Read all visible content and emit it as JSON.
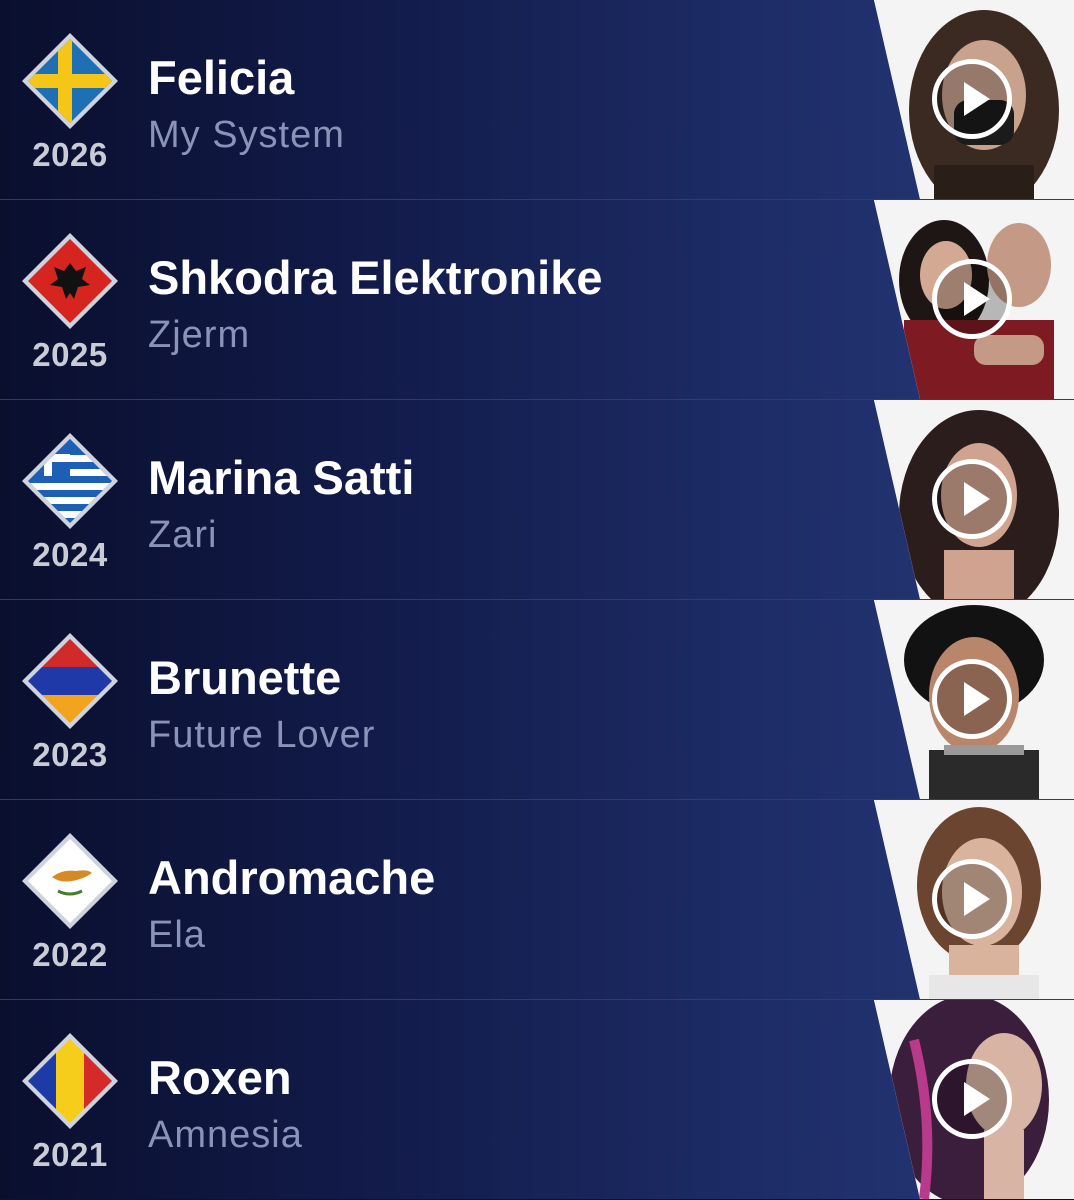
{
  "entries": [
    {
      "year": "2026",
      "artist": "Felicia",
      "song": "My System",
      "flag": "sweden-flag",
      "hair": "#3a2a22",
      "skin": "#c9a28e"
    },
    {
      "year": "2025",
      "artist": "Shkodra Elektronike",
      "song": "Zjerm",
      "flag": "albania-flag",
      "hair": "#1e1614",
      "skin": "#d3a994"
    },
    {
      "year": "2024",
      "artist": "Marina Satti",
      "song": "Zari",
      "flag": "greece-flag",
      "hair": "#2a1d1c",
      "skin": "#cfa38f"
    },
    {
      "year": "2023",
      "artist": "Brunette",
      "song": "Future Lover",
      "flag": "armenia-flag",
      "hair": "#121212",
      "skin": "#b9866c"
    },
    {
      "year": "2022",
      "artist": "Andromache",
      "song": "Ela",
      "flag": "cyprus-flag",
      "hair": "#6b4530",
      "skin": "#d9b39c"
    },
    {
      "year": "2021",
      "artist": "Roxen",
      "song": "Amnesia",
      "flag": "romania-flag",
      "hair": "#3b1d3c",
      "skin": "#d8b4a4"
    }
  ],
  "colors": {
    "sweden_blue": "#1f6fb4",
    "sweden_yellow": "#f5c518",
    "albania_red": "#d6251f",
    "greece_blue": "#1d5fb5",
    "armenia_red": "#d12a2a",
    "armenia_blue": "#1f3aa8",
    "armenia_orange": "#f2a41e",
    "cyprus_copper": "#d68a26",
    "romania_blue": "#1d3ba6",
    "romania_yellow": "#f5cd1a",
    "romania_red": "#d42a28"
  }
}
